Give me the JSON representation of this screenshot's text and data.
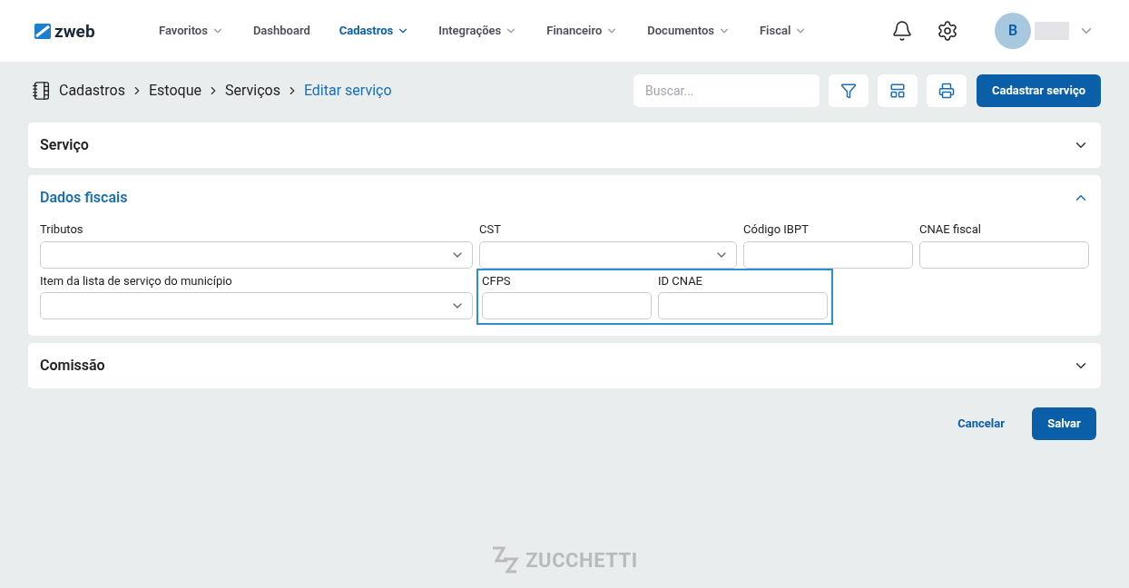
{
  "logo": "zweb",
  "nav": [
    {
      "label": "Favoritos",
      "dropdown": true,
      "selected": false
    },
    {
      "label": "Dashboard",
      "dropdown": false,
      "selected": false
    },
    {
      "label": "Cadastros",
      "dropdown": true,
      "selected": true
    },
    {
      "label": "Integrações",
      "dropdown": true,
      "selected": false
    },
    {
      "label": "Financeiro",
      "dropdown": true,
      "selected": false
    },
    {
      "label": "Documentos",
      "dropdown": true,
      "selected": false
    },
    {
      "label": "Fiscal",
      "dropdown": true,
      "selected": false
    }
  ],
  "user": {
    "initial": "B"
  },
  "breadcrumb": [
    "Cadastros",
    "Estoque",
    "Serviços",
    "Editar serviço"
  ],
  "search": {
    "placeholder": "Buscar..."
  },
  "primary_button": "Cadastrar serviço",
  "sections": [
    {
      "title": "Serviço",
      "expanded": false
    },
    {
      "title": "Dados fiscais",
      "expanded": true,
      "rows": [
        {
          "fields": [
            {
              "label": "Tributos",
              "kind": "select"
            },
            {
              "label": "CST",
              "kind": "select"
            },
            {
              "label": "Código IBPT",
              "kind": "text"
            },
            {
              "label": "CNAE fiscal",
              "kind": "text"
            }
          ]
        },
        {
          "fields": [
            {
              "label": "Item da lista de serviço do município",
              "kind": "select"
            }
          ],
          "highlight_box": {
            "fields": [
              {
                "label": "CFPS",
                "kind": "text"
              },
              {
                "label": "ID CNAE",
                "kind": "text"
              }
            ]
          }
        }
      ]
    },
    {
      "title": "Comissão",
      "expanded": false
    }
  ],
  "actions": {
    "cancel": "Cancelar",
    "save": "Salvar"
  },
  "footer_logo": "ZUCCHETTI"
}
